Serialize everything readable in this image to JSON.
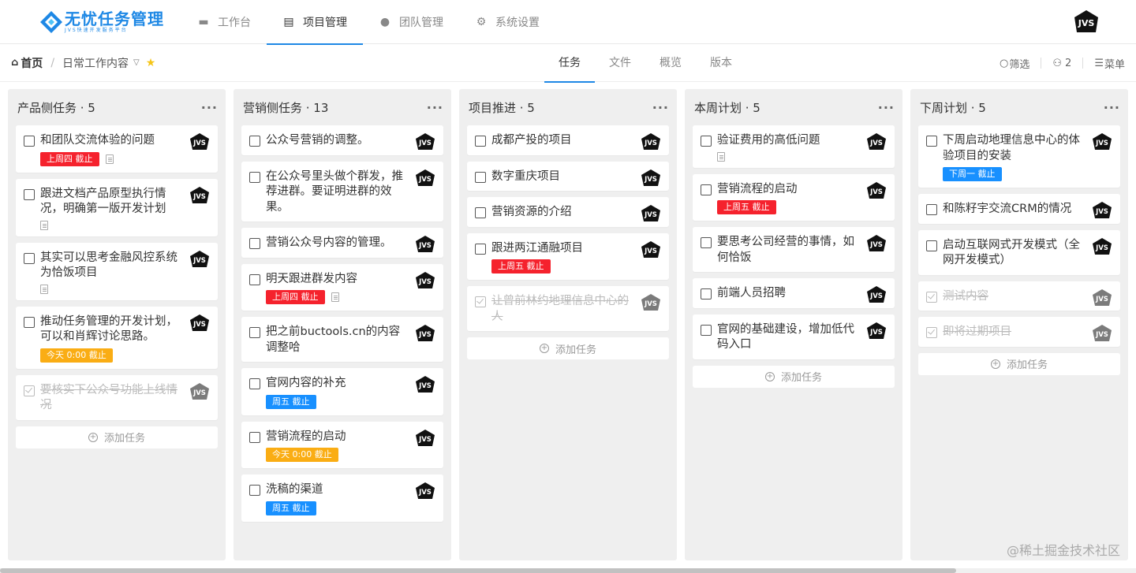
{
  "app": {
    "logo_title": "无忧任务管理",
    "logo_subtitle": "JVS快速开发服务平台",
    "logo_icon": "diamond-logo-icon",
    "brand_color": "#1e88e5",
    "avatar_text": "JVS"
  },
  "nav": {
    "items": [
      {
        "label": "工作台",
        "icon": "monitor-icon"
      },
      {
        "label": "项目管理",
        "icon": "clipboard-icon"
      },
      {
        "label": "团队管理",
        "icon": "user-icon"
      },
      {
        "label": "系统设置",
        "icon": "gear-icon"
      }
    ],
    "active_index": 1
  },
  "breadcrumb": {
    "home": "首页",
    "separator": "/",
    "project": "日常工作内容"
  },
  "tabs": {
    "items": [
      "任务",
      "文件",
      "概览",
      "版本"
    ],
    "active_index": 0
  },
  "tools": {
    "filter": "筛选",
    "members_count": "2",
    "menu": "菜单"
  },
  "colors": {
    "red": "#f5222d",
    "orange": "#faad14",
    "blue": "#1890ff"
  },
  "add_task_label": "添加任务",
  "columns": [
    {
      "title": "产品侧任务 · 5",
      "cards": [
        {
          "title": "和团队交流体验的问题",
          "badge": "上周四 截止",
          "badge_color": "red",
          "doc": true
        },
        {
          "title": "跟进文档产品原型执行情况，明确第一版开发计划",
          "doc": true
        },
        {
          "title": "其实可以思考金融风控系统为恰饭项目",
          "doc": true
        },
        {
          "title": "推动任务管理的开发计划，可以和肖辉讨论思路。",
          "badge": "今天 0:00 截止",
          "badge_color": "orange"
        },
        {
          "title": "要核实下公众号功能上线情况",
          "done": true
        }
      ]
    },
    {
      "title": "营销侧任务 · 13",
      "cards": [
        {
          "title": "公众号营销的调整。"
        },
        {
          "title": "在公众号里头做个群发，推荐进群。要证明进群的效果。"
        },
        {
          "title": "营销公众号内容的管理。"
        },
        {
          "title": "明天跟进群发内容",
          "badge": "上周四 截止",
          "badge_color": "red",
          "doc": true
        },
        {
          "title": "把之前buctools.cn的内容调整哈"
        },
        {
          "title": "官网内容的补充",
          "badge": "周五 截止",
          "badge_color": "blue"
        },
        {
          "title": "营销流程的启动",
          "badge": "今天 0:00 截止",
          "badge_color": "orange"
        },
        {
          "title": "洗稿的渠道",
          "badge": "周五 截止",
          "badge_color": "blue"
        }
      ]
    },
    {
      "title": "项目推进 · 5",
      "cards": [
        {
          "title": "成都产投的项目"
        },
        {
          "title": "数字重庆项目"
        },
        {
          "title": "营销资源的介绍"
        },
        {
          "title": "跟进两江通融项目",
          "badge": "上周五 截止",
          "badge_color": "red"
        },
        {
          "title": "让曾前林约地理信息中心的人",
          "done": true
        }
      ]
    },
    {
      "title": "本周计划 · 5",
      "cards": [
        {
          "title": "验证费用的高低问题",
          "doc": true
        },
        {
          "title": "营销流程的启动",
          "badge": "上周五 截止",
          "badge_color": "red"
        },
        {
          "title": "要思考公司经营的事情，如何恰饭"
        },
        {
          "title": "前端人员招聘"
        },
        {
          "title": "官网的基础建设，增加低代码入口"
        }
      ]
    },
    {
      "title": "下周计划 · 5",
      "cards": [
        {
          "title": "下周启动地理信息中心的体验项目的安装",
          "badge": "下周一 截止",
          "badge_color": "blue"
        },
        {
          "title": "和陈籽宇交流CRM的情况"
        },
        {
          "title": "启动互联网式开发模式（全网开发模式）"
        },
        {
          "title": "测试内容",
          "done": true
        },
        {
          "title": "即将过期项目",
          "done": true
        }
      ]
    }
  ],
  "watermark": "@稀土掘金技术社区"
}
